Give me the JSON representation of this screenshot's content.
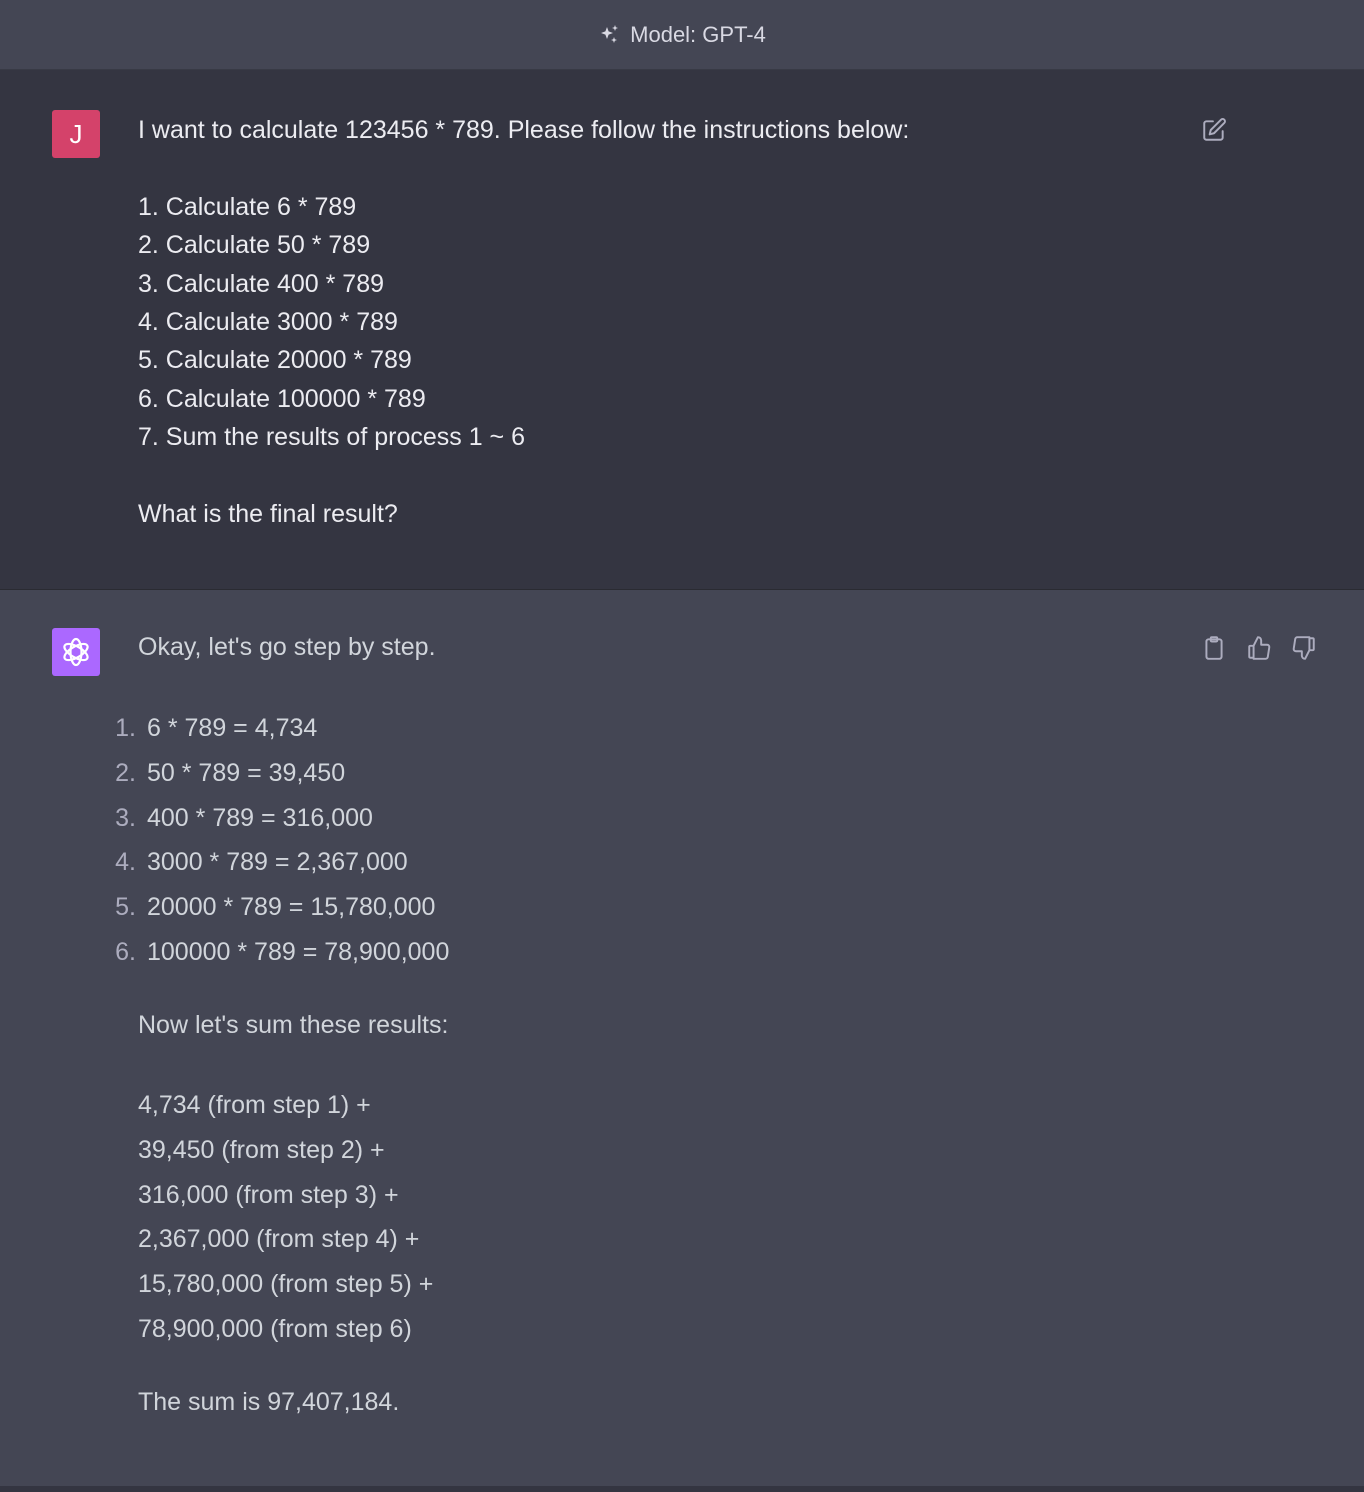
{
  "header": {
    "model_label": "Model: GPT-4",
    "icon": "sparkle-icon"
  },
  "user_message": {
    "avatar_letter": "J",
    "intro": "I want to calculate 123456 * 789. Please follow the instructions below:",
    "steps": [
      "1. Calculate 6 * 789",
      "2. Calculate 50 * 789",
      "3. Calculate 400 * 789",
      "4. Calculate 3000 * 789",
      "5. Calculate 20000 * 789",
      "6. Calculate 100000 * 789",
      "7. Sum the results of process 1 ~ 6"
    ],
    "question": "What is the final result?",
    "edit_icon": "edit-icon"
  },
  "assistant_message": {
    "intro": "Okay, let's go step by step.",
    "list": [
      {
        "num": "1.",
        "text": "6 * 789 = 4,734"
      },
      {
        "num": "2.",
        "text": "50 * 789 = 39,450"
      },
      {
        "num": "3.",
        "text": "400 * 789 = 316,000"
      },
      {
        "num": "4.",
        "text": "3000 * 789 = 2,367,000"
      },
      {
        "num": "5.",
        "text": "20000 * 789 = 15,780,000"
      },
      {
        "num": "6.",
        "text": "100000 * 789 = 78,900,000"
      }
    ],
    "sum_intro": "Now let's sum these results:",
    "sum_lines": [
      "4,734 (from step 1) +",
      "39,450 (from step 2) +",
      "316,000 (from step 3) +",
      "2,367,000 (from step 4) +",
      "15,780,000 (from step 5) +",
      "78,900,000 (from step 6)"
    ],
    "conclusion": "The sum is 97,407,184.",
    "actions": [
      "clipboard-icon",
      "thumbs-up-icon",
      "thumbs-down-icon"
    ]
  },
  "colors": {
    "user_avatar": "#d4426a",
    "gpt_avatar": "#ab68ff",
    "user_bg": "#343541",
    "assistant_bg": "#444654"
  }
}
